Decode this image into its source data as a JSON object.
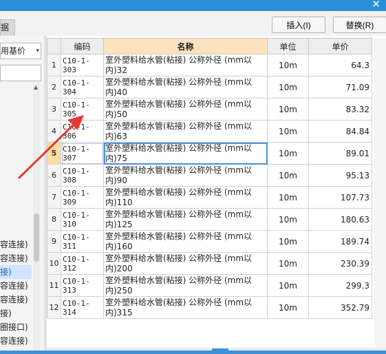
{
  "window": {
    "close_glyph": "✕"
  },
  "left_panel": {
    "tab_label": "据",
    "price_select": {
      "value": "用基价",
      "arrow": "▾"
    },
    "tree_items": [
      {
        "label": "容连接)",
        "selected": false
      },
      {
        "label": "容连接)",
        "selected": false
      },
      {
        "label": "接)",
        "selected": true
      },
      {
        "label": "容连接)",
        "selected": false
      },
      {
        "label": "容连接)",
        "selected": false
      },
      {
        "label": "接)",
        "selected": false
      },
      {
        "label": "圈接口)",
        "selected": false
      },
      {
        "label": "容连接)",
        "selected": false
      }
    ]
  },
  "toolbar": {
    "insert_label": "插入(I)",
    "replace_label": "替换(R)"
  },
  "table": {
    "headers": {
      "index": "",
      "code": "编码",
      "name": "名称",
      "unit": "单位",
      "price": "单价"
    },
    "active_row": 5,
    "rows": [
      {
        "index": "1",
        "code": "C10-1-303",
        "name_line1": "室外塑料给水管(粘接) 公称外径 (mm以",
        "name_line2": "内)32",
        "unit": "10m",
        "price": "64.3"
      },
      {
        "index": "2",
        "code": "C10-1-304",
        "name_line1": "室外塑料给水管(粘接) 公称外径 (mm以",
        "name_line2": "内)40",
        "unit": "10m",
        "price": "71.09"
      },
      {
        "index": "3",
        "code": "C10-1-305",
        "name_line1": "室外塑料给水管(粘接) 公称外径 (mm以",
        "name_line2": "内)50",
        "unit": "10m",
        "price": "83.32"
      },
      {
        "index": "4",
        "code": "C10-1-306",
        "name_line1": "室外塑料给水管(粘接) 公称外径 (mm以",
        "name_line2": "内)63",
        "unit": "10m",
        "price": "84.84"
      },
      {
        "index": "5",
        "code": "C10-1-307",
        "name_line1": "室外塑料给水管(粘接) 公称外径 (mm以",
        "name_line2": "内)75",
        "unit": "10m",
        "price": "89.01"
      },
      {
        "index": "6",
        "code": "C10-1-308",
        "name_line1": "室外塑料给水管(粘接) 公称外径 (mm以",
        "name_line2": "内)90",
        "unit": "10m",
        "price": "95.13"
      },
      {
        "index": "7",
        "code": "C10-1-309",
        "name_line1": "室外塑料给水管(粘接) 公称外径 (mm以",
        "name_line2": "内)110",
        "unit": "10m",
        "price": "107.73"
      },
      {
        "index": "8",
        "code": "C10-1-310",
        "name_line1": "室外塑料给水管(粘接) 公称外径 (mm以",
        "name_line2": "内)125",
        "unit": "10m",
        "price": "180.63"
      },
      {
        "index": "9",
        "code": "C10-1-311",
        "name_line1": "室外塑料给水管(粘接) 公称外径 (mm以",
        "name_line2": "内)160",
        "unit": "10m",
        "price": "189.74"
      },
      {
        "index": "10",
        "code": "C10-1-312",
        "name_line1": "室外塑料给水管(粘接) 公称外径 (mm以",
        "name_line2": "内)200",
        "unit": "10m",
        "price": "230.39"
      },
      {
        "index": "11",
        "code": "C10-1-313",
        "name_line1": "室外塑料给水管(粘接) 公称外径 (mm以",
        "name_line2": "内)250",
        "unit": "10m",
        "price": "299.3"
      },
      {
        "index": "12",
        "code": "C10-1-314",
        "name_line1": "室外塑料给水管(粘接) 公称外径 (mm以",
        "name_line2": "内)315",
        "unit": "10m",
        "price": "352.79"
      }
    ]
  },
  "annotation": {
    "icon": "red-arrow-icon",
    "color": "#e53935"
  }
}
